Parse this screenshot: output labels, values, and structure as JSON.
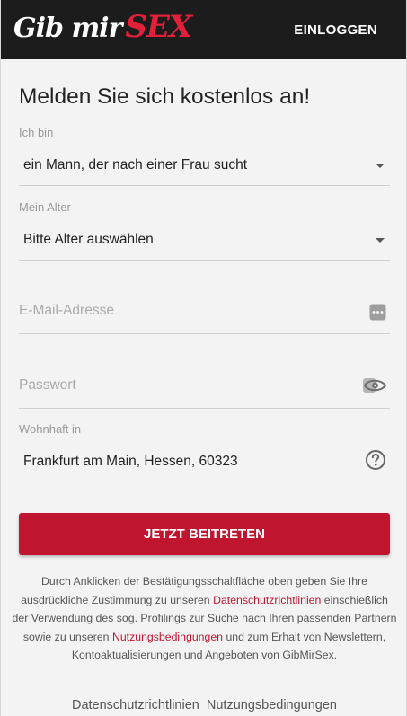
{
  "header": {
    "logo_part1": "Gib mir",
    "logo_part2": "SEX",
    "login_label": "EINLOGGEN"
  },
  "form": {
    "title": "Melden Sie sich kostenlos an!",
    "iam": {
      "label": "Ich bin",
      "value": "ein Mann, der nach einer Frau sucht"
    },
    "age": {
      "label": "Mein Alter",
      "value": "Bitte Alter auswählen"
    },
    "email": {
      "placeholder": "E-Mail-Adresse",
      "icon": "more-dots-icon"
    },
    "password": {
      "placeholder": "Passwort",
      "icon": "eye-icon"
    },
    "location": {
      "label": "Wohnhaft in",
      "value": "Frankfurt am Main, Hessen, 60323",
      "icon": "help-circle-icon"
    },
    "submit_label": "JETZT BEITRETEN"
  },
  "consent": {
    "text1": "Durch Anklicken der Bestätigungsschaltfläche oben geben Sie Ihre ausdrückliche Zustimmung zu unseren ",
    "privacy_link": "Datenschutzrichtlinien",
    "text2": " einschießlich der Verwendung des sog. Profilings zur Suche nach Ihren passenden Partnern sowie zu unseren ",
    "terms_link": "Nutzungsbedingungen",
    "text3": " und zum Erhalt von Newslettern, Kontoaktualisierungen und Angeboten von GibMirSex."
  },
  "footer": {
    "privacy": "Datenschutzrichtlinien",
    "terms": "Nutzungsbedingungen"
  },
  "colors": {
    "brand_red": "#c0152f",
    "logo_red": "#e2203a",
    "header_bg": "#1c1c1c"
  }
}
